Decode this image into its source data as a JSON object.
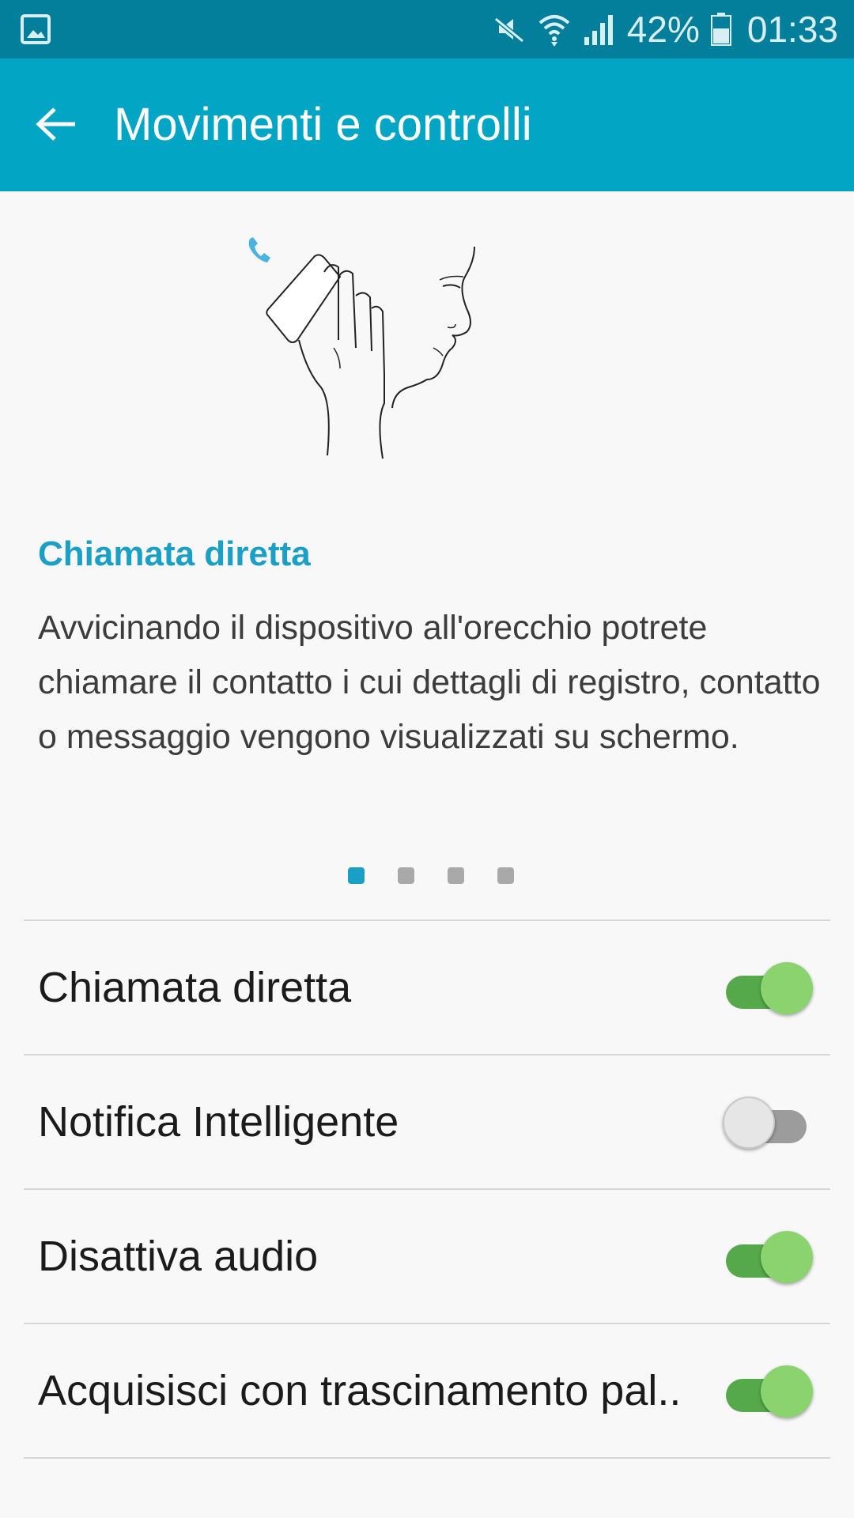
{
  "status_bar": {
    "battery_percent": "42%",
    "time": "01:33",
    "icons": [
      "gallery-icon",
      "mute-icon",
      "wifi-icon",
      "signal-icon",
      "battery-icon"
    ]
  },
  "app_bar": {
    "title": "Movimenti e controlli",
    "back_icon": "arrow-left-icon"
  },
  "illustration": {
    "icon": "direct-call-illustration"
  },
  "feature": {
    "title": "Chiamata diretta",
    "description": "Avvicinando il dispositivo all'orecchio potrete chiamare il contatto i cui dettagli di registro, contatto o messaggio vengono visualizzati su schermo."
  },
  "pager": {
    "total": 4,
    "active_index": 0
  },
  "settings": [
    {
      "label": "Chiamata diretta",
      "enabled": true
    },
    {
      "label": "Notifica Intelligente",
      "enabled": false
    },
    {
      "label": "Disattiva audio",
      "enabled": true
    },
    {
      "label": "Acquisisci con trascinamento pal..",
      "enabled": true
    }
  ],
  "colors": {
    "status_bar": "#037f9b",
    "app_bar": "#02a5c4",
    "accent": "#1a9fc6",
    "switch_on_track": "#56a94a",
    "switch_on_thumb": "#8bd36f"
  }
}
